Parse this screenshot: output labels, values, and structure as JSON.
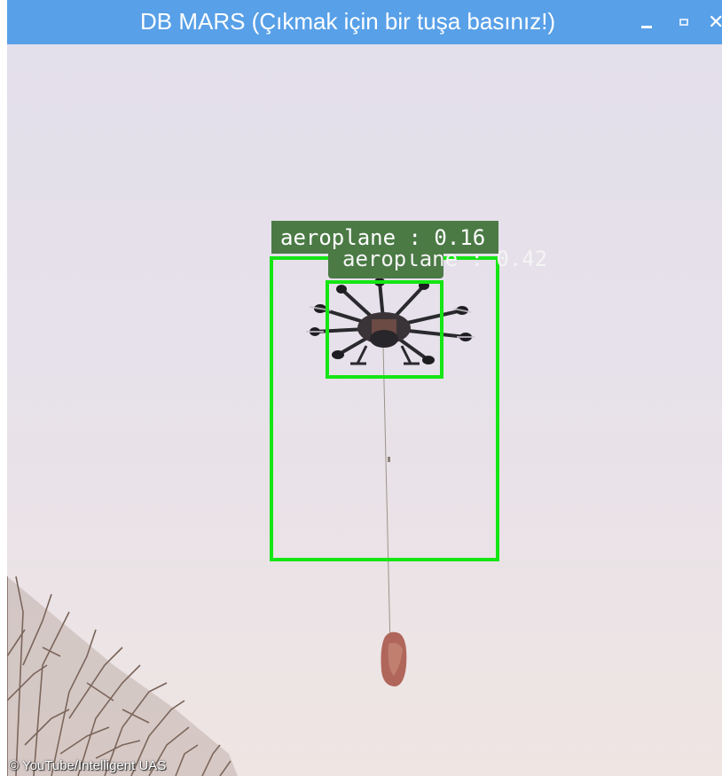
{
  "window": {
    "title": "DB MARS (Çıkmak için bir tuşa basınız!)",
    "buttons": {
      "minimize": "minimize-icon",
      "maximize": "maximize-icon",
      "close": "close-icon"
    },
    "titlebar_color": "#58a0e8"
  },
  "video": {
    "detections": [
      {
        "label": "aeroplane : 0.16",
        "color": "#14e614"
      },
      {
        "label": "aeroplane : 0.42",
        "color": "#14e614"
      }
    ],
    "watermark": "© YouTube/Intelligent UAS"
  }
}
